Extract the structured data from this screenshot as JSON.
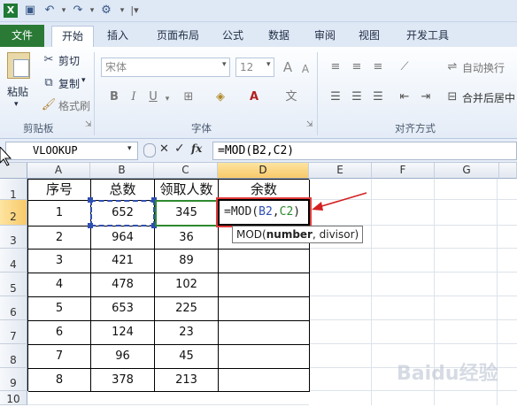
{
  "quick_access": {
    "icons": [
      "excel-logo-icon",
      "save-icon",
      "undo-icon",
      "redo-icon",
      "customize-icon"
    ]
  },
  "tabs": [
    {
      "label": "文件"
    },
    {
      "label": "开始"
    },
    {
      "label": "插入"
    },
    {
      "label": "页面布局"
    },
    {
      "label": "公式"
    },
    {
      "label": "数据"
    },
    {
      "label": "审阅"
    },
    {
      "label": "视图"
    },
    {
      "label": "开发工具"
    }
  ],
  "ribbon": {
    "clipboard": {
      "paste": "粘贴",
      "cut": "剪切",
      "copy": "复制",
      "format_painter": "格式刷",
      "group_label": "剪贴板"
    },
    "font": {
      "font_name": "宋体",
      "font_size": "12",
      "bold": "B",
      "italic": "I",
      "underline": "U",
      "group_label": "字体"
    },
    "alignment": {
      "wrap_text": "自动换行",
      "merge_center": "合并后居中",
      "group_label": "对齐方式"
    }
  },
  "formula_bar": {
    "name_box": "VLOOKUP",
    "cancel": "✕",
    "enter": "✓",
    "fx": "fx",
    "formula": "=MOD(B2,C2)"
  },
  "sheet": {
    "columns": [
      "A",
      "B",
      "C",
      "D",
      "E",
      "F",
      "G"
    ],
    "rows": [
      "1",
      "2",
      "3",
      "4",
      "5",
      "6",
      "7",
      "8",
      "9",
      "10"
    ],
    "header": [
      "序号",
      "总数",
      "领取人数",
      "余数"
    ],
    "data": [
      [
        "1",
        "652",
        "345"
      ],
      [
        "2",
        "964",
        "36"
      ],
      [
        "3",
        "421",
        "89"
      ],
      [
        "4",
        "478",
        "102"
      ],
      [
        "5",
        "653",
        "225"
      ],
      [
        "6",
        "124",
        "23"
      ],
      [
        "7",
        "96",
        "45"
      ],
      [
        "8",
        "378",
        "213"
      ]
    ],
    "edit_cell": {
      "prefix": "=MOD(",
      "ref1": "B2",
      "comma": ",",
      "ref2": "C2",
      "suffix": ")"
    },
    "tooltip": {
      "func": "MOD(",
      "arg1": "number",
      "rest": ", divisor)"
    }
  },
  "colors": {
    "ref1": "#2f4fb0",
    "ref2": "#2e8a2e",
    "arrow": "#d42020",
    "file_tab": "#2a7a36"
  },
  "watermark": "Baidu经验"
}
